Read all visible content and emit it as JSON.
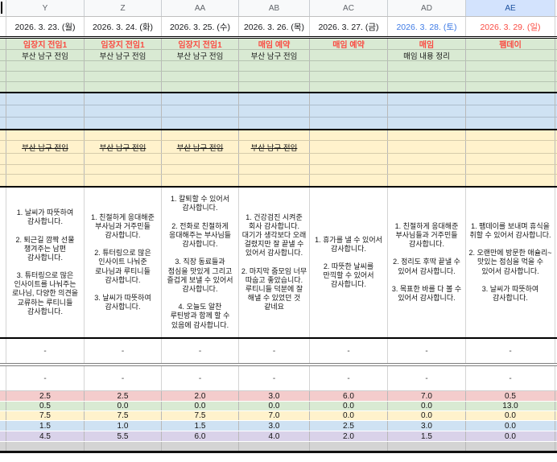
{
  "columns": {
    "letters": [
      "Y",
      "Z",
      "AA",
      "AB",
      "AC",
      "AD",
      "AE"
    ],
    "dates": [
      "2026. 3. 23. (월)",
      "2026. 3. 24. (화)",
      "2026. 3. 25. (수)",
      "2026. 3. 26. (목)",
      "2026. 3. 27. (금)",
      "2026. 3. 28. (토)",
      "2026. 3. 29. (일)"
    ],
    "selected_column": "AE"
  },
  "plan": {
    "headers": [
      "임장지 전임1",
      "임장지 전임1",
      "임장지 전임1",
      "매임 예약",
      "매임 예약",
      "매임",
      "팸데이"
    ],
    "subheaders": [
      "부산 남구 전임",
      "부산 남구 전임",
      "부산 남구 전임",
      "부산 남구 전임",
      "",
      "매임 내용 정리",
      ""
    ],
    "done": [
      "부산 남구 전임",
      "부산 남구 전임",
      "부산 남구 전임",
      "부산 남구 전임",
      "",
      "",
      ""
    ]
  },
  "gratitude": [
    "1. 날씨가 따뜻하여\n감사합니다.\n\n2. 퇴근길 깜짝 선물\n챙겨주는 남편\n감사합니다.\n\n3. 튜터링으로 많은\n인사이트를 나눠주는\n로나님, 다양한 의견을\n교류하는 루티니들\n감사합니다.",
    "1. 친절하게 응대해준\n부사님과 거주민들\n감사합니다.\n\n2. 튜터링으로 많은\n인사이트 나눠준\n로나님과 루티니들\n감사합니다.\n\n3. 날씨가 따뜻하여\n감사합니다.",
    "1. 칼퇴할 수 있어서\n감사합니다.\n\n2. 전화로 친절하게\n응대해주는 부사님들\n감사합니다.\n\n3. 직장 동료들과\n점심을 맛있게 그리고\n즐겁게 보낼 수 있어서\n감사합니다.\n\n4. 오늘도 알찬\n루틴방과 함께 할 수\n있음에 감사합니다.",
    "1. 건강검진 시켜준\n회사 감사합니다.\n대기가 생각보다 오래\n걸렸지만 잘 끝낼 수\n있어서 감사합니다.\n\n2. 마지막 줌모임 너무\n따숩고 좋았습니다.\n루티니들 덕분에 잘\n해낼 수 있었던 것\n같네요",
    "1. 휴가를 낼 수 있어서\n감사합니다.\n\n2. 따뜻한 날씨를\n만끽할 수 있어서\n감사합니다.",
    "1. 친절하게 응대해준\n부사님들과 거주민들\n감사합니다.\n\n2. 정리도 후딱 끝낼 수\n있어서 감사합니다.\n\n3. 목표한 바를 다 볼 수\n있어서 감사합니다.",
    "1. 팸데이를 보내며 휴식을\n취할 수 있어서 감사합니다.\n\n2. 오랜만에 방문한 애슐리~\n맛있는 점심을 먹을 수\n있어서 감사합니다.\n\n3. 날씨가 따뜻하여\n감사합니다."
  ],
  "dashes": {
    "row1": [
      "-",
      "-",
      "-",
      "-",
      "-",
      "-",
      "-"
    ],
    "row2": [
      "-",
      "-",
      "-",
      "-",
      "-",
      "-",
      "-"
    ]
  },
  "scores": {
    "rows": [
      {
        "name": "red",
        "color": "#f4cccc",
        "values": [
          "2.5",
          "2.5",
          "2.0",
          "3.0",
          "6.0",
          "7.0",
          "0.5"
        ]
      },
      {
        "name": "green",
        "color": "#d9ead3",
        "values": [
          "0.5",
          "0.0",
          "0.0",
          "0.0",
          "0.0",
          "0.0",
          "13.0"
        ]
      },
      {
        "name": "yellow",
        "color": "#fff2cc",
        "values": [
          "7.5",
          "7.5",
          "7.5",
          "7.0",
          "0.0",
          "0.0",
          "0.0"
        ]
      },
      {
        "name": "blue",
        "color": "#cfe2f3",
        "values": [
          "1.5",
          "1.0",
          "1.5",
          "3.0",
          "2.5",
          "3.0",
          "0.0"
        ]
      },
      {
        "name": "purple",
        "color": "#d9d2e9",
        "values": [
          "4.5",
          "5.5",
          "6.0",
          "4.0",
          "2.0",
          "1.5",
          "0.0"
        ]
      }
    ]
  },
  "colors": {
    "section_green": "#d9ead3",
    "section_blue": "#cfe2f3",
    "section_yellow": "#fff2cc",
    "section_red": "#f4cccc",
    "section_purple": "#d9d2e9",
    "section_gray": "#d4d4d4",
    "header_red_text": "#fa4b42",
    "saturday_text": "#3d7ae5",
    "sunday_text": "#fa4b42",
    "selected_header_bg": "#d3e3fd"
  }
}
